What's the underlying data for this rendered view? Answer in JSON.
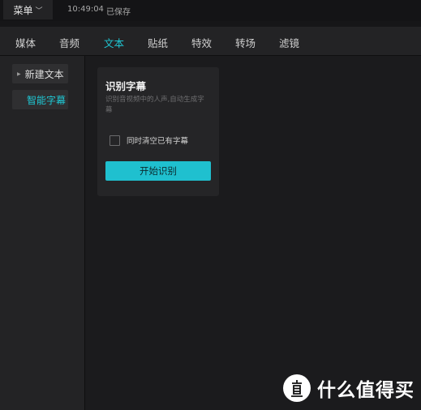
{
  "topbar": {
    "menu_label": "菜单",
    "time": "10:49:04",
    "status": "已保存"
  },
  "tabs": [
    {
      "label": "媒体"
    },
    {
      "label": "音频"
    },
    {
      "label": "文本"
    },
    {
      "label": "贴纸"
    },
    {
      "label": "特效"
    },
    {
      "label": "转场"
    },
    {
      "label": "滤镜"
    }
  ],
  "active_tab": "文本",
  "sidebar": {
    "items": [
      {
        "label": "新建文本"
      },
      {
        "label": "智能字幕"
      }
    ],
    "active": "智能字幕"
  },
  "card": {
    "title": "识别字幕",
    "description": "识别音视频中的人声,自动生成字幕",
    "checkbox_label": "同时清空已有字幕",
    "checkbox_checked": false,
    "start_label": "开始识别"
  },
  "watermark": {
    "text": "什么值得买",
    "logo_char": "值"
  },
  "colors": {
    "accent": "#1fc7d4",
    "button": "#1fc0cf",
    "panel": "#232325",
    "background": "#1b1b1d"
  }
}
